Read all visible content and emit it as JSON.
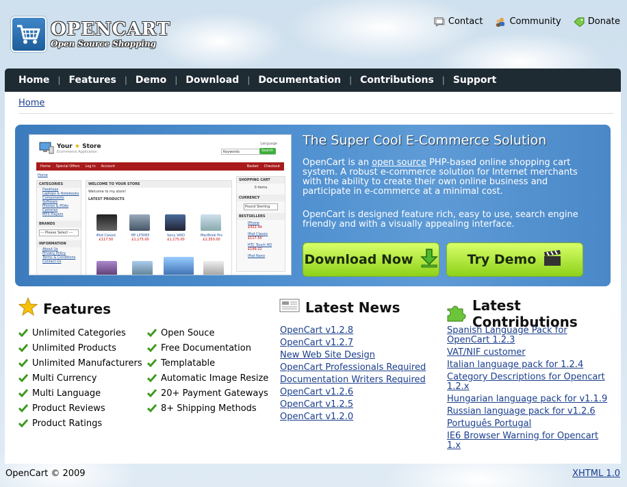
{
  "header": {
    "logo_title": "OPENCART",
    "logo_subtitle": "Open Source Shopping",
    "toplinks": {
      "contact": "Contact",
      "community": "Community",
      "donate": "Donate"
    }
  },
  "nav": {
    "items": [
      "Home",
      "Features",
      "Demo",
      "Download",
      "Documentation",
      "Contributions",
      "Support"
    ]
  },
  "breadcrumb": "Home",
  "banner": {
    "title": "The Super Cool E-Commerce Solution",
    "p1_prefix": "OpenCart is an ",
    "p1_link": "open source",
    "p1_suffix": " PHP-based online shopping cart system. A robust e-commerce solution for Internet merchants with the ability to create their own online business and participate in e-commerce at a minimal cost.",
    "p2": "OpenCart is designed feature rich, easy to use, search engine friendly and with a visually appealing interface.",
    "download_label": "Download Now",
    "demo_label": "Try Demo",
    "screenshot": {
      "store_name": "Your",
      "store_name2": "Store",
      "store_tag": "Ecommerce Application",
      "language": "Language",
      "search_placeholder": "Keywords",
      "search_btn": "Search",
      "bar_left": [
        "Home",
        "Special Offers",
        "Log In",
        "Account"
      ],
      "bar_right": [
        "Basket",
        "Checkout"
      ],
      "breadcrumb": "Home",
      "categories_head": "CATEGORIES",
      "categories": [
        "Desktops",
        "Laptops & Notebooks",
        "Components",
        "Software",
        "Phones & PDAs",
        "Cameras",
        "MP3 Players"
      ],
      "brands_head": "BRANDS",
      "brands_select": "--- Please Select ---",
      "info_head": "INFORMATION",
      "info_links": [
        "About Us",
        "Privacy Policy",
        "Terms & Conditions",
        "Contact Us"
      ],
      "welcome_head": "WELCOME TO YOUR STORE",
      "welcome_text": "Welcome to my store!",
      "latest_head": "LATEST PRODUCTS",
      "products": [
        {
          "name": "iPod Classic",
          "price": "£117.50"
        },
        {
          "name": "HP LP3065",
          "price": "£1,175.00"
        },
        {
          "name": "Sony VAIO",
          "price": "£1,175.00"
        },
        {
          "name": "MacBook Pro",
          "price": "£2,350.00"
        }
      ],
      "cart_head": "SHOPPING CART",
      "cart_text": "0 items",
      "currency_head": "CURRENCY",
      "currency_select": "Pound Sterling",
      "best_head": "BESTSELLERS",
      "best": [
        {
          "name": "iPhone",
          "price": "£422.44"
        },
        {
          "name": "iPod Classic",
          "price": "£117.50"
        },
        {
          "name": "HTC Touch HD",
          "price": "£199.22"
        },
        {
          "name": "iPod Nano",
          "price": ""
        }
      ]
    }
  },
  "features": {
    "title": "Features",
    "col1": [
      "Unlimited Categories",
      "Unlimited Products",
      "Unlimited Manufacturers",
      "Multi Currency",
      "Multi Language",
      "Product Reviews",
      "Product Ratings"
    ],
    "col2": [
      "Open Souce",
      "Free Documentation",
      "Templatable",
      "Automatic Image Resize",
      "20+ Payment Gateways",
      "8+ Shipping Methods"
    ]
  },
  "news": {
    "title": "Latest News",
    "items": [
      "OpenCart v1.2.8",
      "OpenCart v1.2.7",
      "New Web Site Design",
      "OpenCart Professionals Required",
      "Documentation Writers Required",
      "OpenCart v1.2.6",
      "OpenCart v1.2.5",
      "OpenCart v1.2.0"
    ]
  },
  "contributions": {
    "title": "Latest Contributions",
    "items": [
      "Spanish Language Pack for OpenCart 1.2.3",
      "VAT/NIF customer",
      "Italian language pack for 1.2.4",
      "Category Descriptions for Opencart 1.2.x",
      "Hungarian language pack for v1.1.9",
      "Russian language pack for v1.2.6",
      "Português Portugal",
      "IE6 Browser Warning for Opencart 1.x"
    ]
  },
  "footer": {
    "copyright": "OpenCart © 2009",
    "xhtml": "XHTML 1.0"
  },
  "colors": {
    "nav_bg": "#1f2b33",
    "banner": "#4c8dce",
    "button_green": "#8ed21a",
    "link": "#1a3e8c"
  }
}
